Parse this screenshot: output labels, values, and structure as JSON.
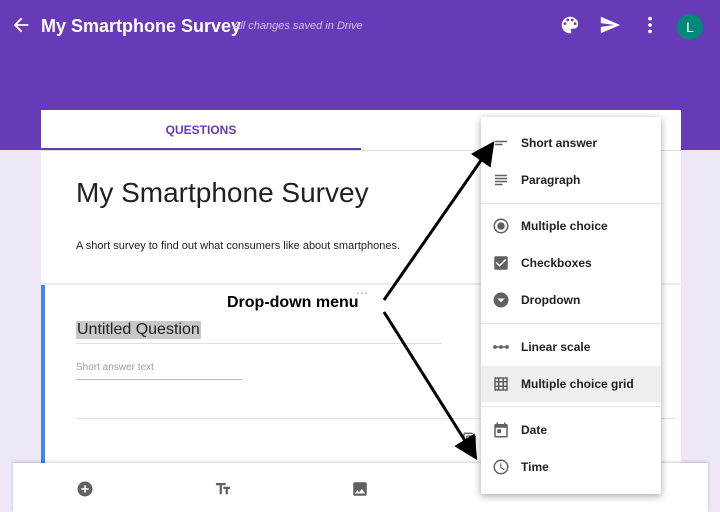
{
  "header": {
    "title": "My Smartphone Survey",
    "saved_status": "All changes saved in Drive",
    "avatar_letter": "L",
    "brand_color": "#673ab7",
    "avatar_color": "#00897b"
  },
  "tabs": [
    {
      "label": "QUESTIONS",
      "active": true
    }
  ],
  "form": {
    "title": "My Smartphone Survey",
    "description": "A short survey to find out what consumers like about smartphones."
  },
  "question": {
    "title": "Untitled Question",
    "answer_placeholder": "Short answer text"
  },
  "annotation": "Drop-down menu",
  "menu": {
    "items": [
      {
        "label": "Short answer",
        "icon": "short-answer-icon"
      },
      {
        "label": "Paragraph",
        "icon": "paragraph-icon"
      },
      {
        "label": "Multiple choice",
        "icon": "radio-icon"
      },
      {
        "label": "Checkboxes",
        "icon": "checkbox-icon"
      },
      {
        "label": "Dropdown",
        "icon": "dropdown-icon"
      },
      {
        "label": "Linear scale",
        "icon": "linear-scale-icon"
      },
      {
        "label": "Multiple choice grid",
        "icon": "grid-icon",
        "highlighted": true
      },
      {
        "label": "Date",
        "icon": "calendar-icon"
      },
      {
        "label": "Time",
        "icon": "clock-icon"
      }
    ]
  }
}
